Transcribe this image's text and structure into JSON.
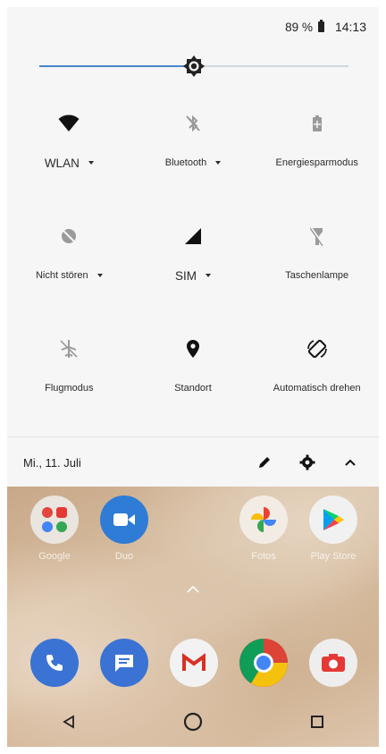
{
  "status_bar": {
    "battery": "89 %",
    "time": "14:13"
  },
  "brightness": {
    "level": 0.5
  },
  "tiles": [
    {
      "label": "WLAN",
      "icon": "wifi-icon",
      "has_dropdown": true
    },
    {
      "label": "Bluetooth",
      "icon": "bluetooth-off-icon",
      "has_dropdown": true
    },
    {
      "label": "Energiesparmodus",
      "icon": "battery-saver-icon",
      "has_dropdown": false
    },
    {
      "label": "Nicht stören",
      "icon": "do-not-disturb-icon",
      "has_dropdown": true
    },
    {
      "label": "SIM",
      "icon": "cellular-signal-icon",
      "has_dropdown": true
    },
    {
      "label": "Taschenlampe",
      "icon": "flashlight-off-icon",
      "has_dropdown": false
    },
    {
      "label": "Flugmodus",
      "icon": "airplane-mode-icon",
      "has_dropdown": false
    },
    {
      "label": "Standort",
      "icon": "location-icon",
      "has_dropdown": false
    },
    {
      "label": "Automatisch drehen",
      "icon": "auto-rotate-icon",
      "has_dropdown": false
    }
  ],
  "footer": {
    "date": "Mi., 11. Juli",
    "icons": [
      "edit-icon",
      "settings-icon",
      "collapse-chevron-icon"
    ]
  },
  "home_screen": {
    "apps_row1": [
      {
        "label": "Google",
        "icon": "google-folder-icon"
      },
      {
        "label": "Duo",
        "icon": "duo-icon"
      },
      {
        "label": "Fotos",
        "icon": "photos-icon"
      },
      {
        "label": "Play Store",
        "icon": "play-store-icon"
      }
    ],
    "dock": [
      {
        "icon": "phone-icon"
      },
      {
        "icon": "messages-icon"
      },
      {
        "icon": "gmail-icon"
      },
      {
        "icon": "chrome-icon"
      },
      {
        "icon": "camera-icon"
      }
    ]
  },
  "nav_bar": {
    "icons": [
      "back-icon",
      "home-icon",
      "recents-icon"
    ]
  }
}
